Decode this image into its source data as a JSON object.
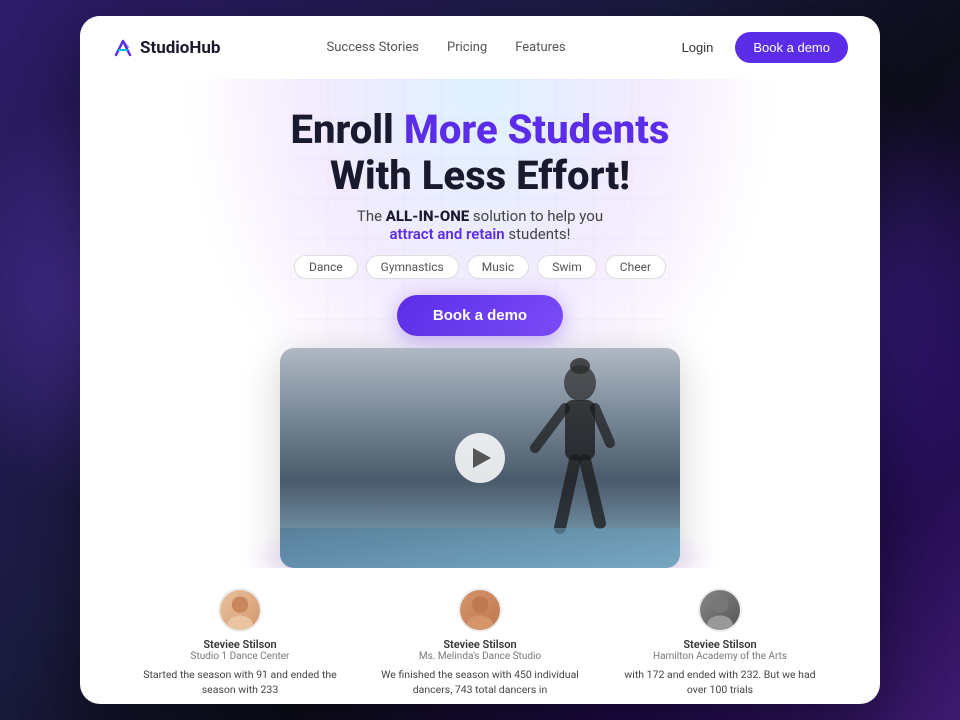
{
  "background": {
    "color": "#1a1a2e"
  },
  "navbar": {
    "logo_text": "StudioHub",
    "links": [
      {
        "label": "Success Stories"
      },
      {
        "label": "Pricing"
      },
      {
        "label": "Features"
      }
    ],
    "login_label": "Login",
    "demo_label": "Book a demo"
  },
  "hero": {
    "title_part1": "Enroll ",
    "title_highlight": "More Students",
    "title_part2": "With Less Effort!",
    "subtitle_prefix": "The ",
    "subtitle_bold": "ALL-IN-ONE",
    "subtitle_mid": " solution to help you ",
    "subtitle_colored": "attract and retain",
    "subtitle_suffix": " students!",
    "cta_label": "Book a demo",
    "tags": [
      "Dance",
      "Gymnastics",
      "Music",
      "Swim",
      "Cheer"
    ]
  },
  "testimonials": [
    {
      "name": "Steviee Stilson",
      "studio": "Studio 1 Dance Center",
      "text": "Started the season with 91 and ended the season with 233",
      "avatar_emoji": "👩"
    },
    {
      "name": "Steviee Stilson",
      "studio": "Ms. Melinda's Dance Studio",
      "text": "We finished the season with 450 individual dancers, 743 total dancers in",
      "avatar_emoji": "👩"
    },
    {
      "name": "Steviee Stilson",
      "studio": "Hamilton Academy of the Arts",
      "text": "with 172 and ended with 232. But we had over 100 trials",
      "avatar_emoji": "👩"
    }
  ]
}
